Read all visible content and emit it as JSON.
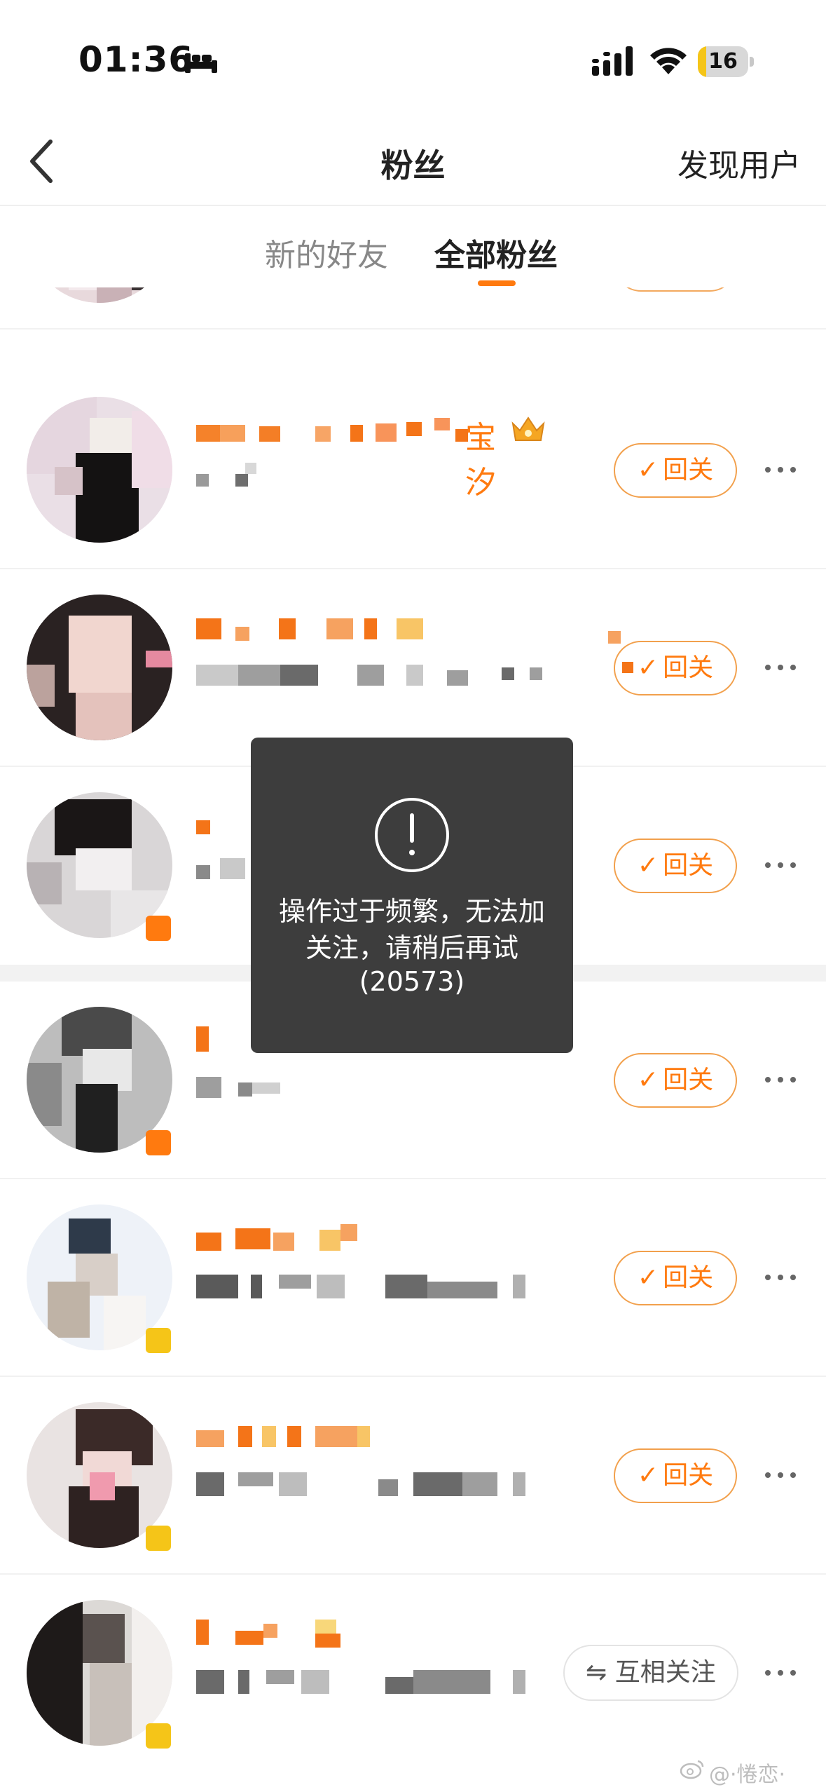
{
  "status_bar": {
    "time": "01:36",
    "battery": "16",
    "battery_level": 0.16
  },
  "nav": {
    "title": "粉丝",
    "right_action": "发现用户"
  },
  "tabs": [
    {
      "label": "新的好友",
      "active": false
    },
    {
      "label": "全部粉丝",
      "active": true
    }
  ],
  "followers": [
    {
      "name_tail": "",
      "action": ""
    },
    {
      "name_tail": "宝汐",
      "action": "回关"
    },
    {
      "name_tail": "",
      "action": "回关"
    },
    {
      "name_tail": "",
      "action": "回关"
    },
    {
      "name_tail": "",
      "action": "回关"
    },
    {
      "name_tail": "",
      "action": "回关"
    },
    {
      "name_tail": "",
      "action": "回关"
    },
    {
      "name_tail": "",
      "action": "互相关注"
    }
  ],
  "toast": {
    "icon": "exclamation-icon",
    "message": "操作过于频繁，无法加关注，请稍后再试",
    "code": "(20573)"
  },
  "watermark": "@·惓恋·",
  "colors": {
    "accent": "#ff7a0f",
    "toast_bg": "#3d3d3d"
  }
}
